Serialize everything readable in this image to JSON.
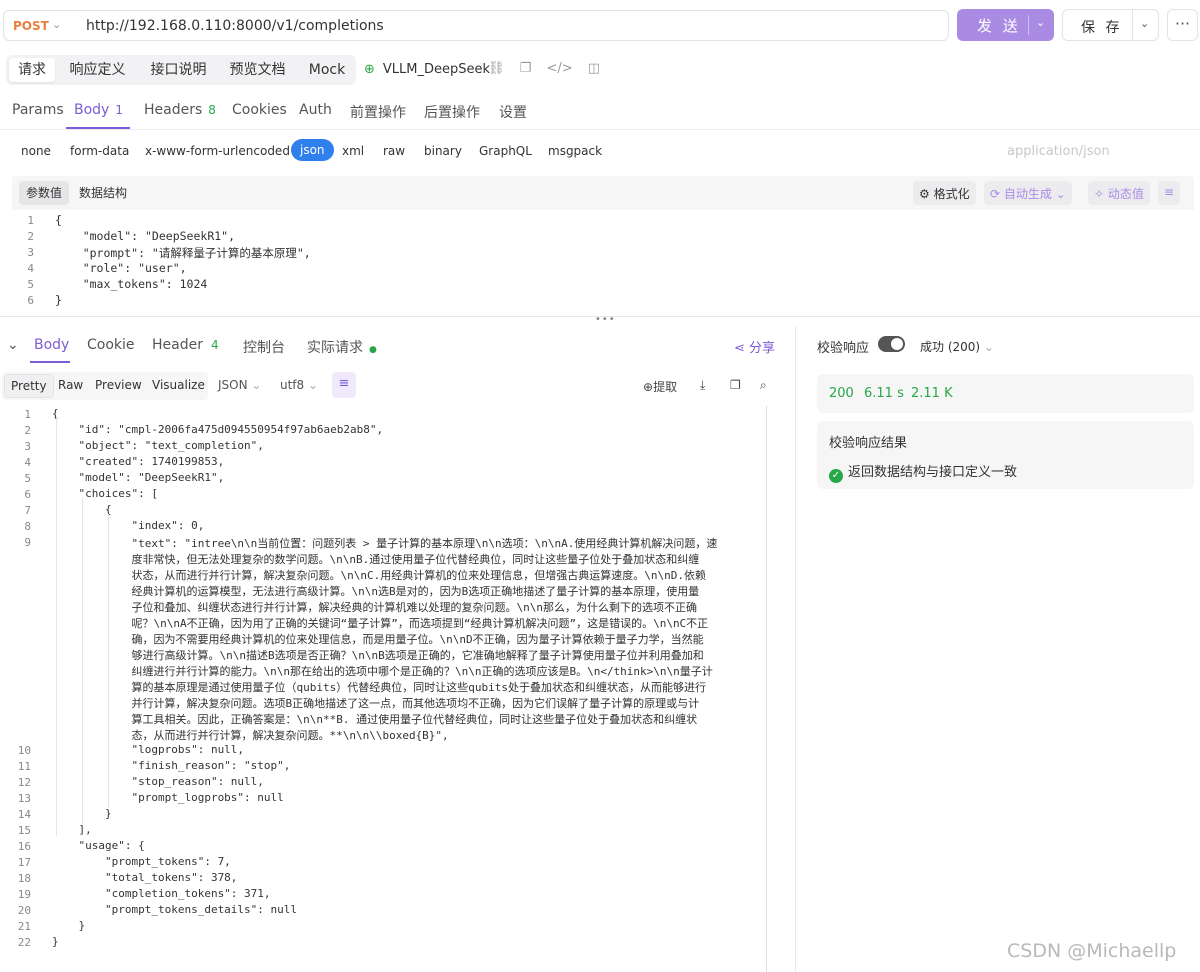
{
  "request": {
    "method": "POST",
    "url": "http://192.168.0.110:8000/v1/completions",
    "send_label": "发 送",
    "save_label": "保 存",
    "more_label": "···"
  },
  "top_tabs": [
    "请求",
    "响应定义",
    "接口说明",
    "预览文档",
    "Mock"
  ],
  "api_name": "VLLM_DeepSeek",
  "request_tabs": [
    {
      "label": "Params",
      "count": ""
    },
    {
      "label": "Body",
      "count": "1"
    },
    {
      "label": "Headers",
      "count": "8"
    },
    {
      "label": "Cookies",
      "count": ""
    },
    {
      "label": "Auth",
      "count": ""
    },
    {
      "label": "前置操作",
      "count": ""
    },
    {
      "label": "后置操作",
      "count": ""
    },
    {
      "label": "设置",
      "count": ""
    }
  ],
  "body_types": [
    "none",
    "form-data",
    "x-www-form-urlencoded",
    "json",
    "xml",
    "raw",
    "binary",
    "GraphQL",
    "msgpack"
  ],
  "content_type": "application/json",
  "editor_toolbar": {
    "tabs": [
      "参数值",
      "数据结构"
    ],
    "format_label": "格式化",
    "auto_gen_label": "自动生成",
    "dynamic_label": "动态值"
  },
  "request_body_lines": [
    {
      "n": "1",
      "text": "{"
    },
    {
      "n": "2",
      "text": "    \"model\": \"DeepSeekR1\","
    },
    {
      "n": "3",
      "text": "    \"prompt\": \"请解释量子计算的基本原理\","
    },
    {
      "n": "4",
      "text": "    \"role\": \"user\","
    },
    {
      "n": "5",
      "text": "    \"max_tokens\": 1024"
    },
    {
      "n": "6",
      "text": "}"
    }
  ],
  "response_tabs": [
    {
      "label": "Body",
      "count": ""
    },
    {
      "label": "Cookie",
      "count": ""
    },
    {
      "label": "Header",
      "count": "4"
    },
    {
      "label": "控制台",
      "count": ""
    },
    {
      "label": "实际请求",
      "count": ""
    }
  ],
  "share_label": "分享",
  "response_formats": [
    "Pretty",
    "Raw",
    "Preview",
    "Visualize"
  ],
  "response_encoding": {
    "format": "JSON",
    "charset": "utf8"
  },
  "extract_label": "提取",
  "response_lines": [
    {
      "n": "1",
      "text": "{"
    },
    {
      "n": "2",
      "text": "    \"id\": \"cmpl-2006fa475d094550954f97ab6aeb2ab8\","
    },
    {
      "n": "3",
      "text": "    \"object\": \"text_completion\","
    },
    {
      "n": "4",
      "text": "    \"created\": 1740199853,"
    },
    {
      "n": "5",
      "text": "    \"model\": \"DeepSeekR1\","
    },
    {
      "n": "6",
      "text": "    \"choices\": ["
    },
    {
      "n": "7",
      "text": "        {"
    },
    {
      "n": "8",
      "text": "            \"index\": 0,"
    },
    {
      "n": "9",
      "text": "            \"text\": \"intree\\n\\n当前位置：问题列表 > 量子计算的基本原理\\n\\n选项：\\n\\nA.使用经典计算机解决问题，速"
    },
    {
      "n": "",
      "text": "            度非常快，但无法处理复杂的数学问题。\\n\\nB.通过使用量子位代替经典位，同时让这些量子位处于叠加状态和纠缠"
    },
    {
      "n": "",
      "text": "            状态，从而进行并行计算，解决复杂问题。\\n\\nC.用经典计算机的位来处理信息，但增强古典运算速度。\\n\\nD.依赖"
    },
    {
      "n": "",
      "text": "            经典计算机的运算模型，无法进行高级计算。\\n\\n选B是对的，因为B选项正确地描述了量子计算的基本原理，使用量"
    },
    {
      "n": "",
      "text": "            子位和叠加、纠缠状态进行并行计算，解决经典的计算机难以处理的复杂问题。\\n\\n那么，为什么剩下的选项不正确"
    },
    {
      "n": "",
      "text": "            呢？\\n\\nA不正确，因为用了正确的关键词“量子计算”，而选项提到“经典计算机解决问题”，这是错误的。\\n\\nC不正"
    },
    {
      "n": "",
      "text": "            确，因为不需要用经典计算机的位来处理信息，而是用量子位。\\n\\nD不正确，因为量子计算依赖于量子力学，当然能"
    },
    {
      "n": "",
      "text": "            够进行高级计算。\\n\\n描述B选项是否正确？\\n\\nB选项是正确的，它准确地解释了量子计算使用量子位并利用叠加和"
    },
    {
      "n": "",
      "text": "            纠缠进行并行计算的能力。\\n\\n那在给出的选项中哪个是正确的？\\n\\n正确的选项应该是B。\\n</think>\\n\\n量子计"
    },
    {
      "n": "",
      "text": "            算的基本原理是通过使用量子位（qubits）代替经典位，同时让这些qubits处于叠加状态和纠缠状态，从而能够进行"
    },
    {
      "n": "",
      "text": "            并行计算，解决复杂问题。选项B正确地描述了这一点，而其他选项均不正确，因为它们误解了量子计算的原理或与计"
    },
    {
      "n": "",
      "text": "            算工具相关。因此，正确答案是：\\n\\n**B. 通过使用量子位代替经典位，同时让这些量子位处于叠加状态和纠缠状"
    },
    {
      "n": "",
      "text": "            态，从而进行并行计算，解决复杂问题。**\\n\\n\\\\boxed{B}\","
    },
    {
      "n": "10",
      "text": "            \"logprobs\": null,"
    },
    {
      "n": "11",
      "text": "            \"finish_reason\": \"stop\","
    },
    {
      "n": "12",
      "text": "            \"stop_reason\": null,"
    },
    {
      "n": "13",
      "text": "            \"prompt_logprobs\": null"
    },
    {
      "n": "14",
      "text": "        }"
    },
    {
      "n": "15",
      "text": "    ],"
    },
    {
      "n": "16",
      "text": "    \"usage\": {"
    },
    {
      "n": "17",
      "text": "        \"prompt_tokens\": 7,"
    },
    {
      "n": "18",
      "text": "        \"total_tokens\": 378,"
    },
    {
      "n": "19",
      "text": "        \"completion_tokens\": 371,"
    },
    {
      "n": "20",
      "text": "        \"prompt_tokens_details\": null"
    },
    {
      "n": "21",
      "text": "    }"
    },
    {
      "n": "22",
      "text": "}"
    }
  ],
  "validation": {
    "label": "校验响应",
    "enabled": true,
    "result_select": "成功 (200)",
    "status_code": "200",
    "time": "6.11 s",
    "size": "2.11 K",
    "result_title": "校验响应结果",
    "result_message": "返回数据结构与接口定义一致"
  },
  "watermark": "CSDN @Michaellp",
  "colors": {
    "accent": "#7b5cd6",
    "send_button": "#a98be4",
    "success": "#27a745",
    "method": "#e8803c",
    "json_chip": "#2f80ed"
  }
}
